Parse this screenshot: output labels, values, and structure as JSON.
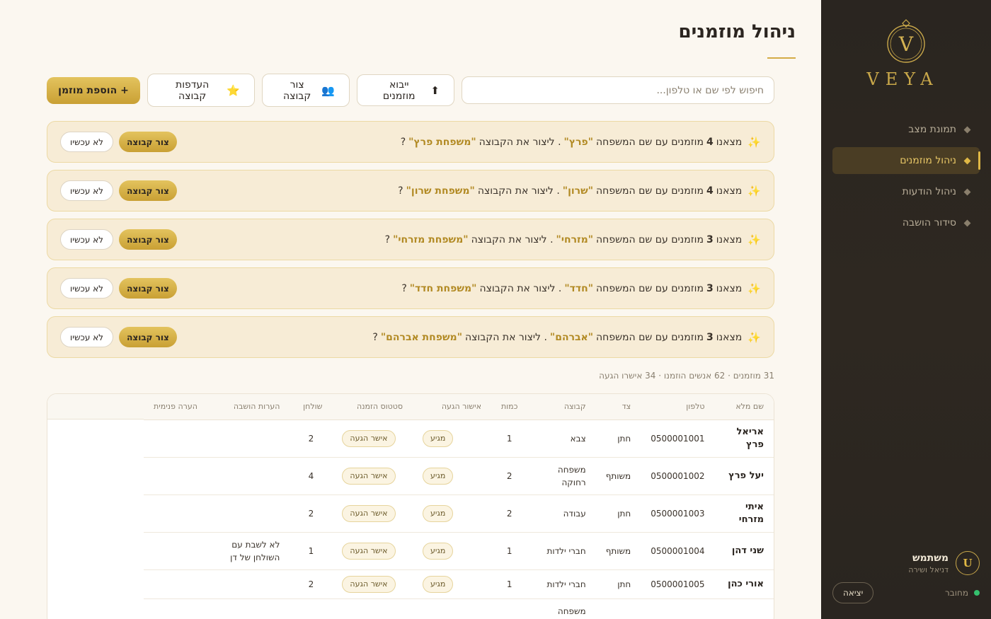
{
  "brand": {
    "name": "VEYA",
    "monogram": "V"
  },
  "nav": [
    {
      "label": "תמונת מצב",
      "active": false
    },
    {
      "label": "ניהול מוזמנים",
      "active": true
    },
    {
      "label": "ניהול הודעות",
      "active": false
    },
    {
      "label": "סידור הושבה",
      "active": false
    }
  ],
  "user": {
    "initial": "U",
    "name": "משתמש",
    "subtitle": "דניאל ושירה",
    "status": "מחובר",
    "logout": "יציאה"
  },
  "page": {
    "title": "ניהול מוזמנים"
  },
  "toolbar": {
    "search_placeholder": "חיפוש לפי שם או טלפון...",
    "import_label": "ייבוא מוזמנים",
    "import_icon": "⬆",
    "group_label": "צור קבוצה",
    "group_icon": "👥",
    "prefs_label": "העדפות קבוצה",
    "prefs_icon": "⭐",
    "add_label": "+ הוספת מוזמן"
  },
  "suggestions": {
    "icon": "✨",
    "prefix": "מצאנו",
    "middle": "מוזמנים עם שם המשפחה",
    "ask": ". ליצור את הקבוצה",
    "end": "?",
    "create_label": "צור קבוצה",
    "later_label": "לא עכשיו",
    "items": [
      {
        "count": "4",
        "family": "\"פרץ\"",
        "group": "\"משפחת פרץ\""
      },
      {
        "count": "4",
        "family": "\"שרון\"",
        "group": "\"משפחת שרון\""
      },
      {
        "count": "3",
        "family": "\"מזרחי\"",
        "group": "\"משפחת מזרחי\""
      },
      {
        "count": "3",
        "family": "\"חדד\"",
        "group": "\"משפחת חדד\""
      },
      {
        "count": "3",
        "family": "\"אברהם\"",
        "group": "\"משפחת אברהם\""
      }
    ]
  },
  "stats": "31 מוזמנים · 62 אנשים הוזמנו · 34 אישרו הגעה",
  "table": {
    "columns": [
      "שם מלא",
      "טלפון",
      "צד",
      "קבוצה",
      "כמות",
      "אישור הגעה",
      "סטטוס הזמנה",
      "שולחן",
      "הערות הושבה",
      "הערה פנימית"
    ],
    "rows": [
      {
        "name": "אריאל פרץ",
        "phone": "0500001001",
        "side": "חתן",
        "group": "צבא",
        "qty": "1",
        "rsvp": "מגיע",
        "status": "אישר הגעה",
        "table": "2",
        "seat_note": "",
        "internal": ""
      },
      {
        "name": "יעל פרץ",
        "phone": "0500001002",
        "side": "משותף",
        "group": "משפחה רחוקה",
        "qty": "2",
        "rsvp": "מגיע",
        "status": "אישר הגעה",
        "table": "4",
        "seat_note": "",
        "internal": ""
      },
      {
        "name": "איתי מזרחי",
        "phone": "0500001003",
        "side": "חתן",
        "group": "עבודה",
        "qty": "2",
        "rsvp": "מגיע",
        "status": "אישר הגעה",
        "table": "2",
        "seat_note": "",
        "internal": ""
      },
      {
        "name": "שני דהן",
        "phone": "0500001004",
        "side": "משותף",
        "group": "חברי ילדות",
        "qty": "1",
        "rsvp": "מגיע",
        "status": "אישר הגעה",
        "table": "1",
        "seat_note": "לא לשבת עם השולחן של דן",
        "internal": ""
      },
      {
        "name": "אורי כהן",
        "phone": "0500001005",
        "side": "חתן",
        "group": "חברי ילדות",
        "qty": "1",
        "rsvp": "מגיע",
        "status": "אישר הגעה",
        "table": "2",
        "seat_note": "",
        "internal": ""
      },
      {
        "name": "",
        "phone": "",
        "side": "",
        "group": "משפחה",
        "qty": "",
        "rsvp": "",
        "status": "",
        "table": "",
        "seat_note": "",
        "internal": ""
      }
    ]
  },
  "colors": {
    "accent": "#d4ac46",
    "sidebar_bg": "#2a2520",
    "page_bg": "#fbf7f0",
    "online": "#35c16e"
  }
}
